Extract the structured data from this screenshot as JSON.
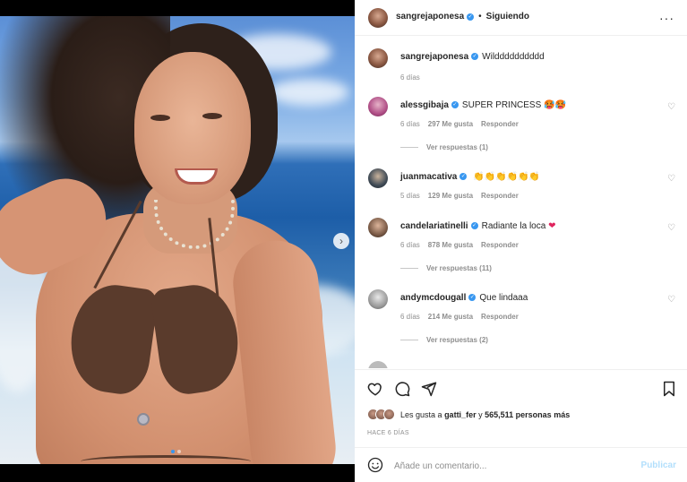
{
  "post": {
    "author": "sangrejaponesa",
    "follow_status": "Siguiendo",
    "more_icon": "more-horizontal-icon"
  },
  "caption": {
    "username": "sangrejaponesa",
    "text": "Wildddddddddd",
    "time": "6 días"
  },
  "comments": [
    {
      "username": "alessgibaja",
      "text": "SUPER PRINCESS",
      "emoji": "🥵🥵",
      "time": "6 días",
      "likes": "297 Me gusta",
      "reply": "Responder",
      "view_replies": "Ver respuestas (1)"
    },
    {
      "username": "juanmacativa",
      "text": "",
      "emoji": "👏👏👏👏👏👏",
      "time": "5 días",
      "likes": "129 Me gusta",
      "reply": "Responder",
      "view_replies": ""
    },
    {
      "username": "candelariatinelli",
      "text": "Radiante la loca",
      "emoji": "❤",
      "time": "6 días",
      "likes": "878 Me gusta",
      "reply": "Responder",
      "view_replies": "Ver respuestas (11)"
    },
    {
      "username": "andymcdougall",
      "text": "Que lindaaa",
      "emoji": "",
      "time": "6 días",
      "likes": "214 Me gusta",
      "reply": "Responder",
      "view_replies": "Ver respuestas (2)"
    }
  ],
  "likes_summary": {
    "prefix": "Les gusta a",
    "user": "gatti_fer",
    "connector": "y",
    "count": "565,511",
    "suffix": "personas más"
  },
  "post_time": "HACE 6 DÍAS",
  "composer": {
    "placeholder": "Añade un comentario...",
    "publish": "Publicar"
  },
  "carousel": {
    "current": 1,
    "total": 2
  },
  "colors": {
    "accent": "#3897f0",
    "publish_disabled": "#b2dffc",
    "muted": "#8e8e8e"
  }
}
